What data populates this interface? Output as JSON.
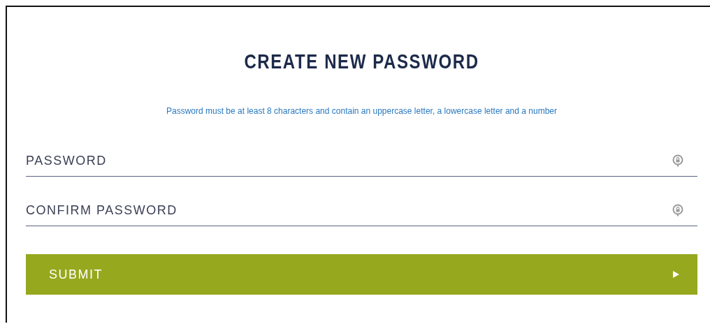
{
  "title": "CREATE NEW PASSWORD",
  "hint": "Password must be at least 8 characters and contain an uppercase letter, a lowercase letter and a number",
  "fields": [
    {
      "placeholder": "PASSWORD"
    },
    {
      "placeholder": "CONFIRM PASSWORD"
    }
  ],
  "submit": {
    "label": "SUBMIT"
  }
}
